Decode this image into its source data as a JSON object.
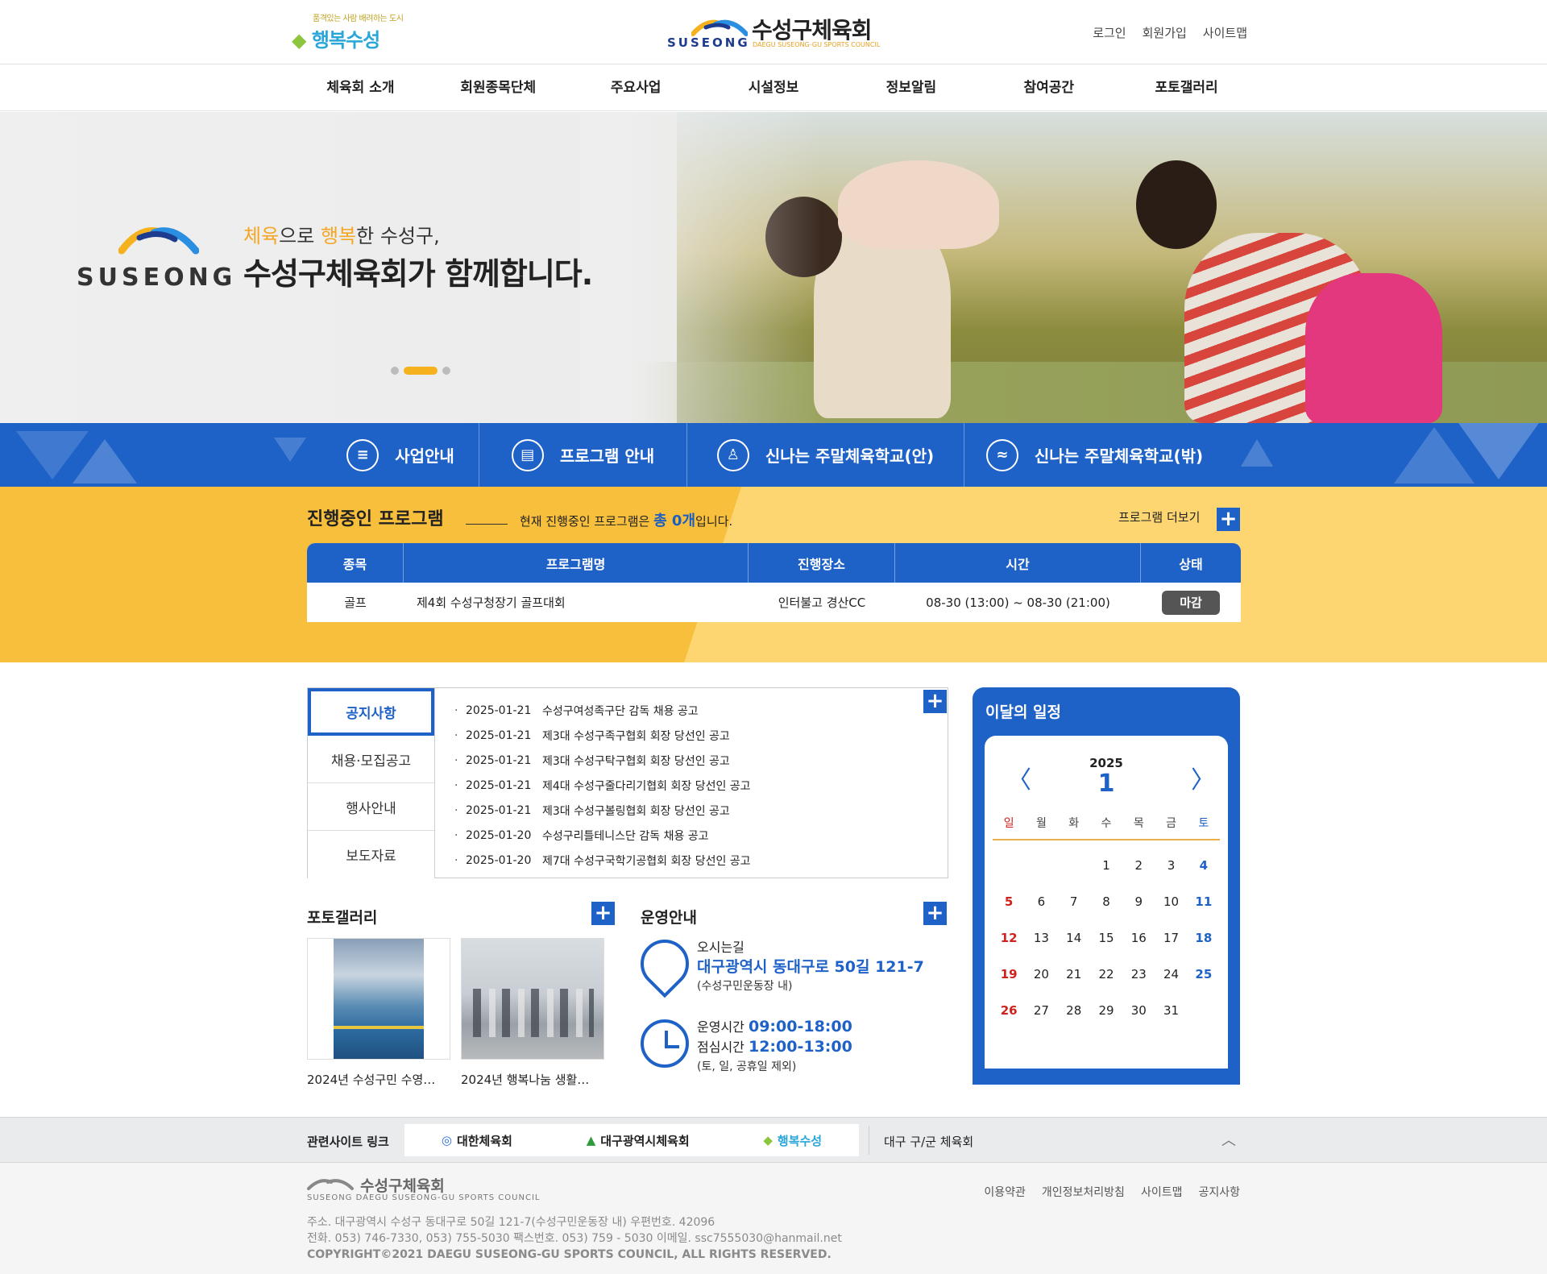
{
  "header": {
    "left_logo_slogan": "품격있는 사람 배려하는 도시",
    "left_logo_name": "행복수성",
    "center_logo_kor": "수성구체육회",
    "center_logo_eng": "SUSEONG",
    "center_logo_sub": "DAEGU SUSEONG-GU SPORTS COUNCIL",
    "util": [
      "로그인",
      "회원가입",
      "사이트맵"
    ]
  },
  "gnb": [
    "체육회 소개",
    "회원종목단체",
    "주요사업",
    "시설정보",
    "정보알림",
    "참여공간",
    "포토갤러리"
  ],
  "hero": {
    "logo_word": "SUSEONG",
    "line1_a": "체육",
    "line1_b": "으로 ",
    "line1_c": "행복",
    "line1_d": "한 수성구,",
    "line2": "수성구체육회가 함께합니다.",
    "slide_count": 3,
    "active_slide": 2
  },
  "quick": [
    {
      "label": "사업안내",
      "icon": "chat-icon"
    },
    {
      "label": "프로그램 안내",
      "icon": "presentation-icon"
    },
    {
      "label": "신나는 주말체육학교(안)",
      "icon": "shirt-icon"
    },
    {
      "label": "신나는 주말체육학교(밖)",
      "icon": "swim-icon"
    }
  ],
  "program": {
    "title": "진행중인 프로그램",
    "desc_pre": "현재 진행중인 프로그램은 ",
    "desc_count": "총 0개",
    "desc_post": "입니다.",
    "more": "프로그램 더보기",
    "headers": [
      "종목",
      "프로그램명",
      "진행장소",
      "시간",
      "상태"
    ],
    "rows": [
      {
        "sport": "골프",
        "name": "제4회 수성구청장기 골프대회",
        "place": "인터불고 경산CC",
        "time": "08-30 (13:00) ~ 08-30 (21:00)",
        "status": "마감"
      }
    ]
  },
  "notice": {
    "tabs": [
      "공지사항",
      "채용·모집공고",
      "행사안내",
      "보도자료"
    ],
    "active_tab": 0,
    "items": [
      {
        "date": "2025-01-21",
        "title": "수성구여성족구단 감독 채용 공고"
      },
      {
        "date": "2025-01-21",
        "title": "제3대 수성구족구협회 회장 당선인 공고"
      },
      {
        "date": "2025-01-21",
        "title": "제3대 수성구탁구협회 회장 당선인 공고"
      },
      {
        "date": "2025-01-21",
        "title": "제4대 수성구줄다리기협회 회장 당선인 공고"
      },
      {
        "date": "2025-01-21",
        "title": "제3대 수성구볼링협회 회장 당선인 공고"
      },
      {
        "date": "2025-01-20",
        "title": "수성구리틀테니스단 감독 채용 공고"
      },
      {
        "date": "2025-01-20",
        "title": "제7대 수성구국학기공협회 회장 당선인 공고"
      }
    ]
  },
  "gallery": {
    "title": "포토갤러리",
    "items": [
      {
        "caption": "2024년 수성구민 수영…"
      },
      {
        "caption": "2024년 행복나눔 생활…"
      }
    ]
  },
  "operation": {
    "title": "운영안내",
    "location_label": "오시는길",
    "address": "대구광역시 동대구로 50길 121-7",
    "address_sub": "(수성구민운동장 내)",
    "hours_label": "운영시간",
    "hours": "09:00-18:00",
    "lunch_label": "점심시간",
    "lunch": "12:00-13:00",
    "closed": "(토, 일, 공휴일 제외)"
  },
  "calendar": {
    "title": "이달의 일정",
    "year": "2025",
    "month": "1",
    "dows": [
      "일",
      "월",
      "화",
      "수",
      "목",
      "금",
      "토"
    ],
    "cells": [
      "",
      "",
      "",
      "1",
      "2",
      "3",
      "4",
      "5",
      "6",
      "7",
      "8",
      "9",
      "10",
      "11",
      "12",
      "13",
      "14",
      "15",
      "16",
      "17",
      "18",
      "19",
      "20",
      "21",
      "22",
      "23",
      "24",
      "25",
      "26",
      "27",
      "28",
      "29",
      "30",
      "31",
      ""
    ]
  },
  "related": {
    "label": "관련사이트 링크",
    "logos": [
      "대한체육회",
      "대구광역시체육회",
      "행복수성"
    ],
    "select": "대구 구/군 체육회"
  },
  "footer": {
    "logo_kor": "수성구체육회",
    "logo_eng": "SUSEONG DAEGU SUSEONG-GU SPORTS COUNCIL",
    "menu": [
      "이용약관",
      "개인정보처리방침",
      "사이트맵",
      "공지사항"
    ],
    "address": "주소. 대구광역시 수성구 동대구로 50길 121-7(수성구민운동장 내)   우편번호. 42096",
    "contact": "전화. 053) 746-7330, 053) 755-5030   팩스번호. 053) 759 - 5030   이메일. ssc7555030@hanmail.net",
    "copyright": "COPYRIGHT©2021 DAEGU SUSEONG-GU SPORTS COUNCIL, ALL RIGHTS RESERVED."
  },
  "colors": {
    "primary": "#1e62c8",
    "accent": "#f5b21e",
    "yellow_bg": "#f7bf3b",
    "closed_badge": "#555555"
  }
}
